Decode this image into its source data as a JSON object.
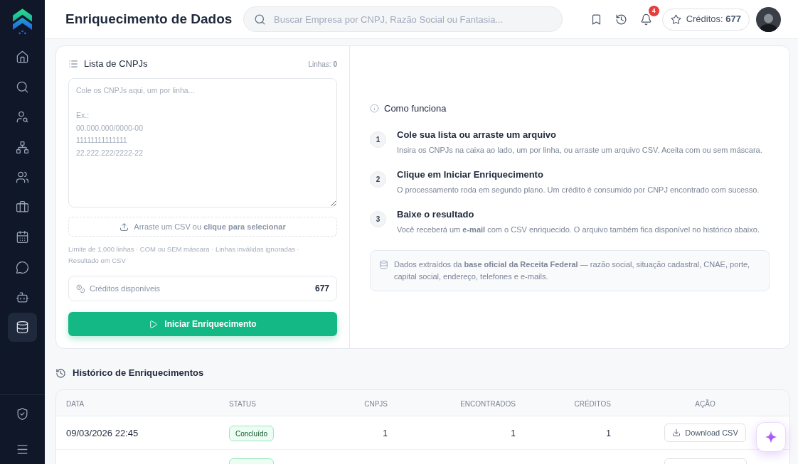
{
  "sidebar": {
    "items": [
      {
        "selected": false
      },
      {
        "selected": false
      },
      {
        "selected": false
      },
      {
        "selected": false
      },
      {
        "selected": false
      },
      {
        "selected": false
      },
      {
        "selected": false
      },
      {
        "selected": false
      },
      {
        "selected": false
      },
      {
        "selected": true
      }
    ]
  },
  "header": {
    "title": "Enriquecimento de Dados",
    "search": {
      "placeholder": "Buscar Empresa por CNPJ, Razão Social ou Fantasia..."
    },
    "notifications": "4",
    "credits": "Créditos: **677**"
  },
  "cnpj_panel": {
    "title": "Lista de CNPJs",
    "lines": "Linhas: **0**",
    "textarea": {
      "placeholder": "Cole os CNPJs aqui, um por linha...\n\nEx.:\n00.000.000/0000-00\n11111111111111\n22.222.222/2222-22"
    },
    "dropzone": "Arraste um CSV ou **clique para selecionar**",
    "hint": "Limite de 1.000 linhas · COM ou SEM máscara · Linhas inválidas ignoradas · Resultado em CSV",
    "credits": {
      "label": "Créditos disponíveis",
      "value": "677"
    },
    "start_button": "Iniciar Enriquecimento"
  },
  "how_it_works": {
    "title": "Como funciona",
    "steps": [
      {
        "number": "1",
        "title": "Cole sua lista ou arraste um arquivo",
        "description": "Insira os CNPJs na caixa ao lado, um por linha, ou arraste um arquivo CSV. Aceita com ou sem máscara."
      },
      {
        "number": "2",
        "title": "Clique em Iniciar Enriquecimento",
        "description": "O processamento roda em segundo plano. Um crédito é consumido por CNPJ encontrado com sucesso."
      },
      {
        "number": "3",
        "title": "Baixe o resultado",
        "description": "Você receberá um **e-mail** com o CSV enriquecido. O arquivo também fica disponível no histórico abaixo."
      }
    ],
    "note": "Dados extraídos da **base oficial da Receita Federal** — razão social, situação cadastral, CNAE, porte, capital social, endereço, telefones e e-mails."
  },
  "history": {
    "title": "Histórico de Enriquecimentos",
    "table": {
      "columns": [
        "DATA",
        "STATUS",
        "CNPJS",
        "ENCONTRADOS",
        "CRÉDITOS",
        "AÇÃO"
      ],
      "rows": [
        {
          "date": "09/03/2026 22:45",
          "status": "Concluído",
          "cnpjs": "1",
          "found": "1",
          "credits": "1",
          "action": "Download CSV"
        }
      ]
    }
  }
}
